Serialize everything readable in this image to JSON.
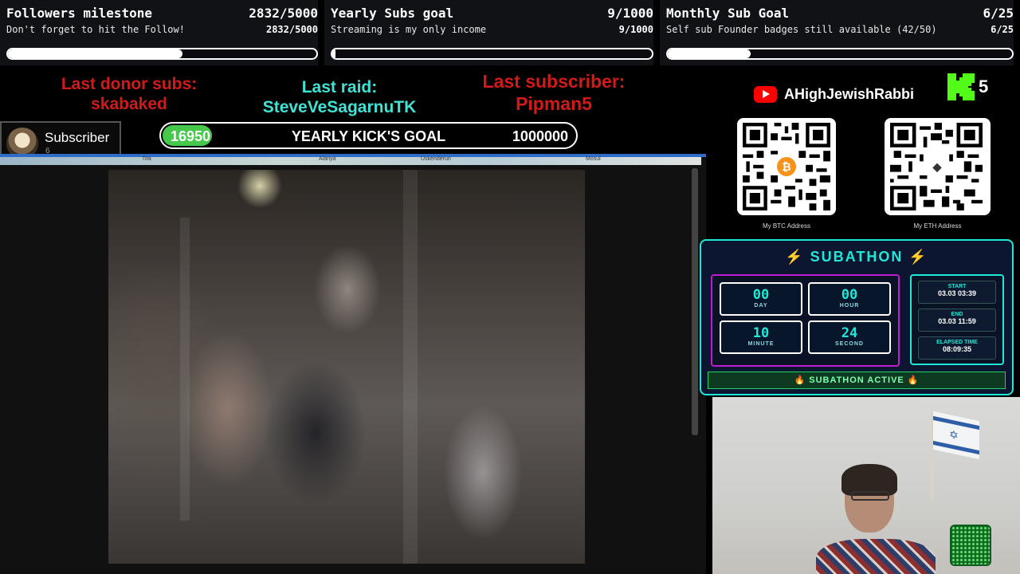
{
  "goals": [
    {
      "title": "Followers milestone",
      "count": "2832/5000",
      "subtitle": "Don't forget to hit the Follow!",
      "subcount": "2832/5000",
      "progress": 0.566
    },
    {
      "title": "Yearly Subs goal",
      "count": "9/1000",
      "subtitle": "Streaming is my only income",
      "subcount": "9/1000",
      "progress": 0.009
    },
    {
      "title": "Monthly Sub Goal",
      "count": "6/25",
      "subtitle": "Self sub Founder badges still available (42/50)",
      "subcount": "6/25",
      "progress": 0.24
    }
  ],
  "events": {
    "donor_label": "Last donor subs:",
    "donor_name": "skabaked",
    "raid_label": "Last raid:",
    "raid_name": "SteveVeSagarnuTK",
    "subscriber_label": "Last subscriber:",
    "subscriber_name": "Pipman5"
  },
  "subscriber_card": {
    "label": "Subscriber",
    "count": "6"
  },
  "kick_goal": {
    "current": "16950",
    "title": "YEARLY KICK'S GOAL",
    "target": "1000000",
    "progress": 0.01695
  },
  "channel": {
    "name": "AHighJewishRabbi",
    "kick_count": "5"
  },
  "qr": {
    "btc_label": "My BTC Address",
    "eth_label": "My ETH Address",
    "btc_symbol": "₿",
    "eth_symbol": "◆"
  },
  "map_labels": [
    "Tira",
    "Alanya",
    "Uskenderun",
    "Mosul"
  ],
  "subathon": {
    "title": "SUBATHON",
    "bolt": "⚡",
    "timer": [
      {
        "value": "00",
        "unit": "DAY"
      },
      {
        "value": "00",
        "unit": "HOUR"
      },
      {
        "value": "10",
        "unit": "MINUTE"
      },
      {
        "value": "24",
        "unit": "SECOND"
      }
    ],
    "start_label": "START",
    "start_value": "03.03 03:39",
    "end_label": "END",
    "end_value": "03.03 11:59",
    "elapsed_label": "ELAPSED TIME",
    "elapsed_value": "08:09:35",
    "status": "🔥 SUBATHON ACTIVE 🔥"
  },
  "colors": {
    "kick_green": "#53fc18",
    "donor_red": "#d11a1a",
    "raid_cyan": "#3fe3d5",
    "subathon_accent": "#1de9d6",
    "subathon_magenta": "#c01bd0"
  }
}
